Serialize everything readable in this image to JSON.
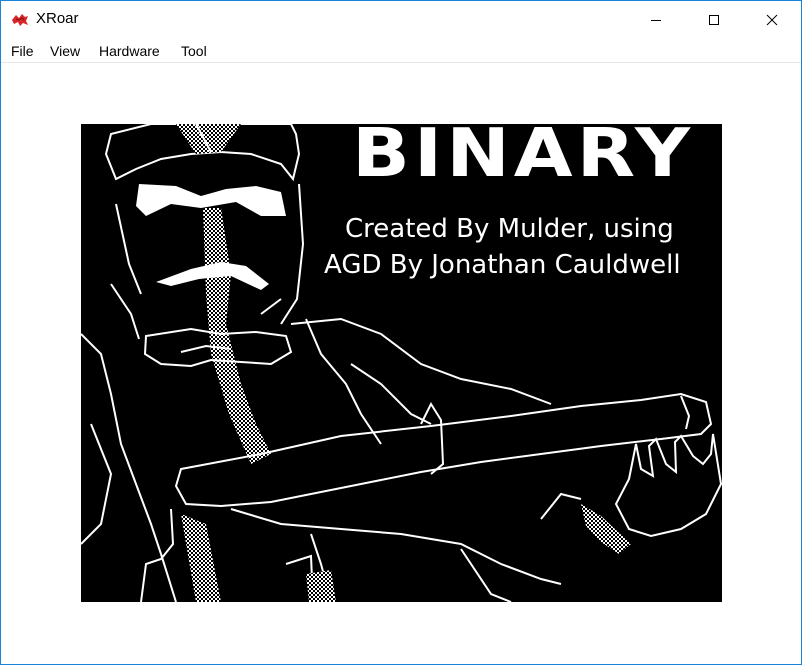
{
  "window": {
    "title": "XRoar",
    "icons": {
      "app": "dragon-icon",
      "minimize": "minimize-icon",
      "maximize": "maximize-icon",
      "close": "close-icon"
    }
  },
  "menu": {
    "items": [
      {
        "label": "File"
      },
      {
        "label": "View"
      },
      {
        "label": "Hardware"
      },
      {
        "label": "Tool"
      }
    ]
  },
  "screen": {
    "game_title": "BINARY",
    "credit_line_1": "Created By Mulder, using",
    "credit_line_2": "AGD By Jonathan Cauldwell",
    "colors": {
      "background": "#000000",
      "foreground": "#ffffff"
    }
  }
}
